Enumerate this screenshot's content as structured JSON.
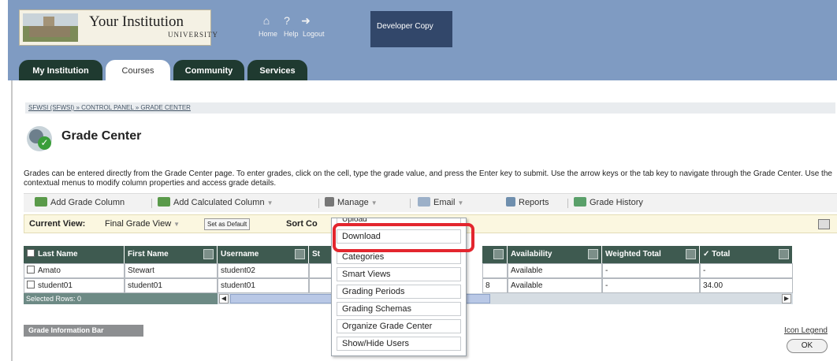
{
  "institution": {
    "name": "Your Institution",
    "sub": "UNIVERSITY"
  },
  "topnav": {
    "home": "Home",
    "help": "Help",
    "logout": "Logout"
  },
  "developer_copy": "Developer Copy",
  "tabs": [
    "My Institution",
    "Courses",
    "Community",
    "Services"
  ],
  "breadcrumb": "SFWSI (SFWSI) » CONTROL PANEL » GRADE CENTER",
  "page_title": "Grade Center",
  "instructions": "Grades can be entered directly from the Grade Center page. To enter grades, click on the cell, type the grade value, and press the Enter key to submit. Use the arrow keys or the tab key to navigate through the Grade Center. Use the contextual menus to modify column properties and access grade details.",
  "toolbar": {
    "add_grade_column": "Add Grade Column",
    "add_calculated_column": "Add Calculated Column",
    "manage": "Manage",
    "email": "Email",
    "reports": "Reports",
    "grade_history": "Grade History"
  },
  "viewbar": {
    "current_view_label": "Current View:",
    "current_view_value": "Final Grade View",
    "set_default": "Set as Default",
    "sort_label": "Sort Co"
  },
  "grid": {
    "headers": [
      "Last Name",
      "First Name",
      "Username",
      "St",
      "Availability",
      "Weighted Total",
      "Total"
    ],
    "rows": [
      {
        "last": "Amato",
        "first": "Stewart",
        "username": "student02",
        "partial": "",
        "availability": "Available",
        "weighted": "-",
        "total": "-"
      },
      {
        "last": "student01",
        "first": "student01",
        "username": "student01",
        "partial": "8",
        "availability": "Available",
        "weighted": "-",
        "total": "34.00"
      }
    ],
    "selected_rows": "Selected Rows: 0"
  },
  "grade_info_bar": "Grade Information Bar",
  "icon_legend": "Icon Legend",
  "ok_button": "OK",
  "manage_menu": {
    "items": [
      "Upload",
      "Download",
      "Categories",
      "Smart Views",
      "Grading Periods",
      "Grading Schemas",
      "Organize Grade Center",
      "Show/Hide Users"
    ]
  },
  "colors": {
    "banner": "#7f9bc2",
    "tab_dark": "#1f3a30",
    "grid_header": "#3e5a50",
    "highlight": "#e3262e"
  }
}
